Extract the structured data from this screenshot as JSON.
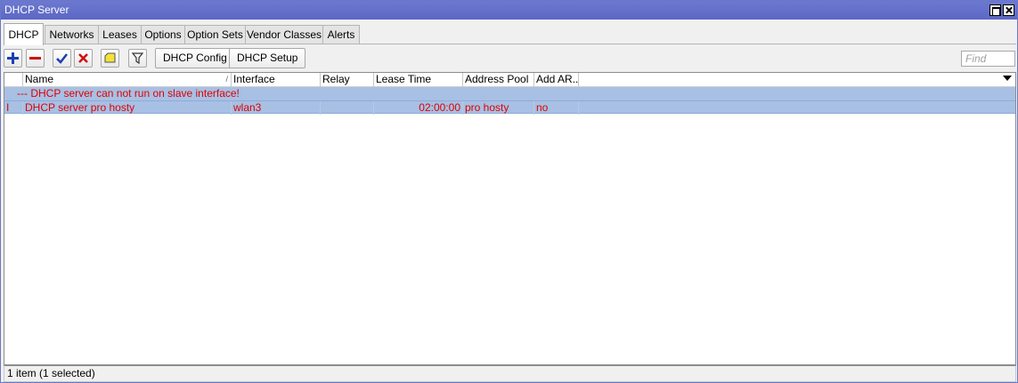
{
  "window": {
    "title": "DHCP Server"
  },
  "tabs": [
    {
      "label": "DHCP",
      "active": true
    },
    {
      "label": "Networks"
    },
    {
      "label": "Leases"
    },
    {
      "label": "Options"
    },
    {
      "label": "Option Sets"
    },
    {
      "label": "Vendor Classes"
    },
    {
      "label": "Alerts"
    }
  ],
  "toolbar": {
    "icons": [
      "add-icon",
      "remove-icon",
      "enable-check-icon",
      "disable-x-icon",
      "comment-icon",
      "filter-icon"
    ],
    "dhcp_config_label": "DHCP Config",
    "dhcp_setup_label": "DHCP Setup",
    "find_placeholder": "Find"
  },
  "table": {
    "columns": [
      "Name",
      "Interface",
      "Relay",
      "Lease Time",
      "Address Pool",
      "Add AR..."
    ],
    "sort_indicator": "/",
    "comment_row": "--- DHCP server can not run on slave interface!",
    "rows": [
      {
        "flag": "I",
        "name": "DHCP server pro hosty",
        "interface": "wlan3",
        "relay": "",
        "lease_time": "02:00:00",
        "address_pool": "pro hosty",
        "add_arp": "no"
      }
    ]
  },
  "colors": {
    "selection": "#a7c0e4",
    "invalid_text": "#e00000",
    "titlebar": "#6370c9"
  },
  "status": {
    "text": "1 item (1 selected)"
  }
}
